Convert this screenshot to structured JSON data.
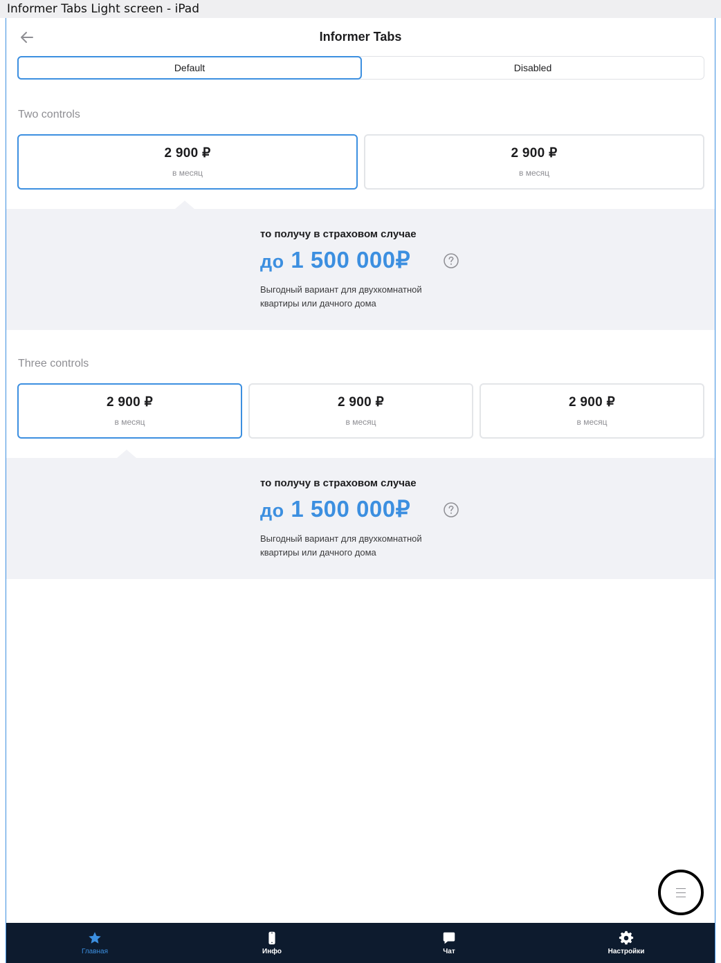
{
  "frame_title": "Informer Tabs Light screen - iPad",
  "header": {
    "title": "Informer Tabs"
  },
  "segments": [
    {
      "label": "Default",
      "active": true
    },
    {
      "label": "Disabled",
      "active": false
    }
  ],
  "sections": [
    {
      "label": "Two controls",
      "controls": [
        {
          "price": "2 900 ₽",
          "period": "в месяц",
          "active": true
        },
        {
          "price": "2 900 ₽",
          "period": "в месяц",
          "active": false
        }
      ],
      "informer": {
        "caption": "то получу в страховом случае",
        "amount_prefix": "до",
        "amount": "1 500 000₽",
        "description": "Выгодный вариант для  двухкомнатной квартиры или дачного дома"
      }
    },
    {
      "label": "Three controls",
      "controls": [
        {
          "price": "2 900 ₽",
          "period": "в месяц",
          "active": true
        },
        {
          "price": "2 900 ₽",
          "period": "в месяц",
          "active": false
        },
        {
          "price": "2 900 ₽",
          "period": "в месяц",
          "active": false
        }
      ],
      "informer": {
        "caption": "то получу в страховом случае",
        "amount_prefix": "до",
        "amount": "1 500 000₽",
        "description": "Выгодный вариант для  двухкомнатной квартиры или дачного дома"
      }
    }
  ],
  "tabbar": {
    "items": [
      {
        "label": "Главная",
        "icon": "star-icon",
        "active": true
      },
      {
        "label": "Инфо",
        "icon": "phone-icon",
        "active": false
      },
      {
        "label": "Чат",
        "icon": "chat-icon",
        "active": false
      },
      {
        "label": "Настройки",
        "icon": "gear-icon",
        "active": false
      }
    ]
  },
  "colors": {
    "accent": "#3c8fe0",
    "informer_bg": "#f1f2f6",
    "tabbar_bg": "#0d1b2e",
    "muted_text": "#8e8e93"
  }
}
